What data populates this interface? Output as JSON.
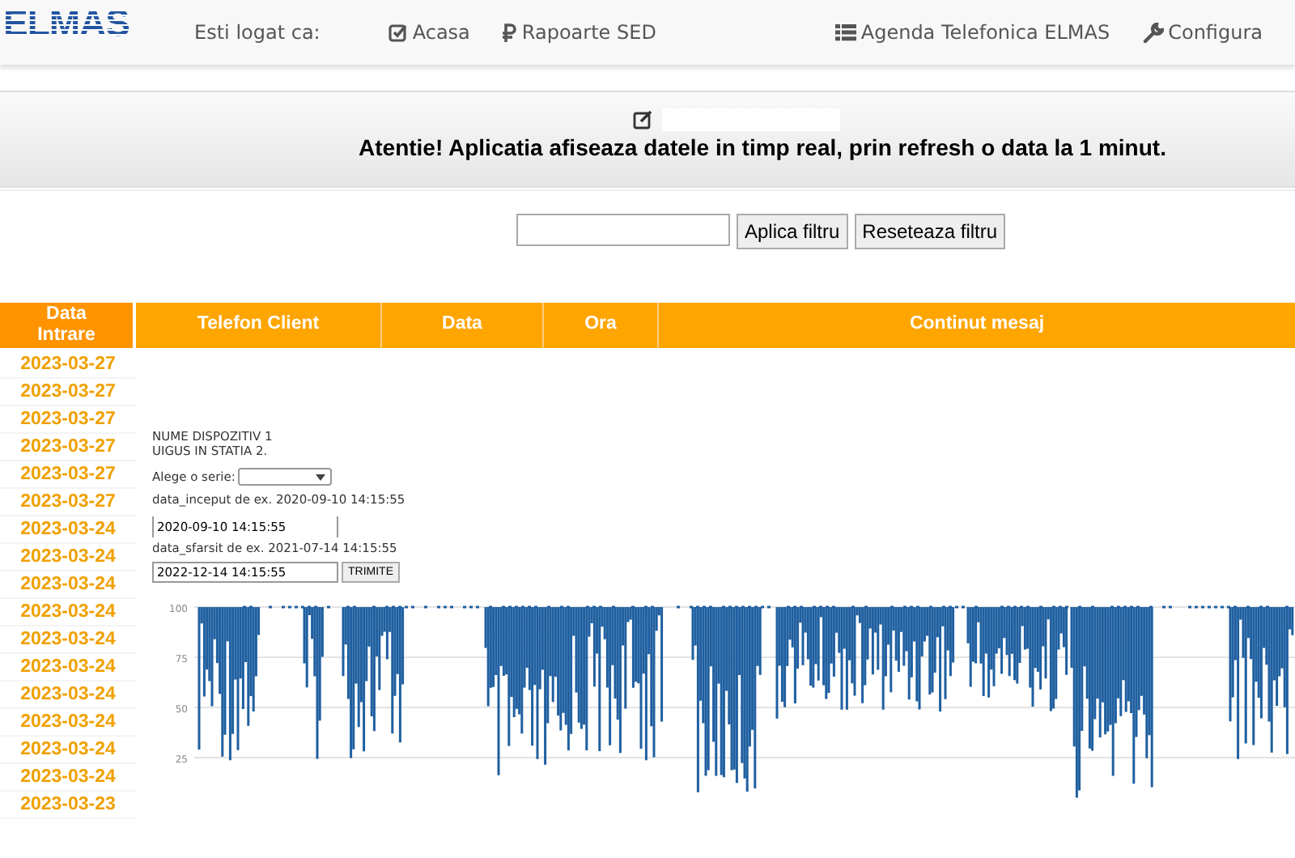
{
  "header": {
    "logo": "ELMAS",
    "logged_in_label": "Esti logat ca:",
    "nav": [
      {
        "label": "Acasa"
      },
      {
        "label": "Rapoarte SED"
      },
      {
        "label": "Agenda Telefonica ELMAS"
      },
      {
        "label": "Configura"
      }
    ]
  },
  "notice": {
    "message": "Atentie! Aplicatia afiseaza datele in timp real, prin refresh o data la 1 minut."
  },
  "filter": {
    "buttons": [
      "Aplica filtru",
      "Reseteaza filtru"
    ]
  },
  "table": {
    "columns": [
      "Data Intrare",
      "Telefon Client",
      "Data",
      "Ora",
      "Continut mesaj"
    ],
    "dates": [
      "2023-03-27",
      "2023-03-27",
      "2023-03-27",
      "2023-03-27",
      "2023-03-27",
      "2023-03-27",
      "2023-03-24",
      "2023-03-24",
      "2023-03-24",
      "2023-03-24",
      "2023-03-24",
      "2023-03-24",
      "2023-03-24",
      "2023-03-24",
      "2023-03-24",
      "2023-03-24",
      "2023-03-23"
    ]
  },
  "device": {
    "lines": [
      "NUME DISPOZITIV 1",
      "UIGUS IN STATIA 2."
    ],
    "series_label": "Alege o serie:",
    "start_hint": "data_inceput de ex. 2020-09-10 14:15:55",
    "start_value": "2020-09-10 14:15:55",
    "end_hint": "data_sfarsit de ex. 2021-07-14 14:15:55",
    "end_value": "2022-12-14 14:15:55",
    "submit": "TRIMITE"
  },
  "chart": {
    "y_labels": [
      "100",
      "75",
      "50",
      "25"
    ]
  }
}
